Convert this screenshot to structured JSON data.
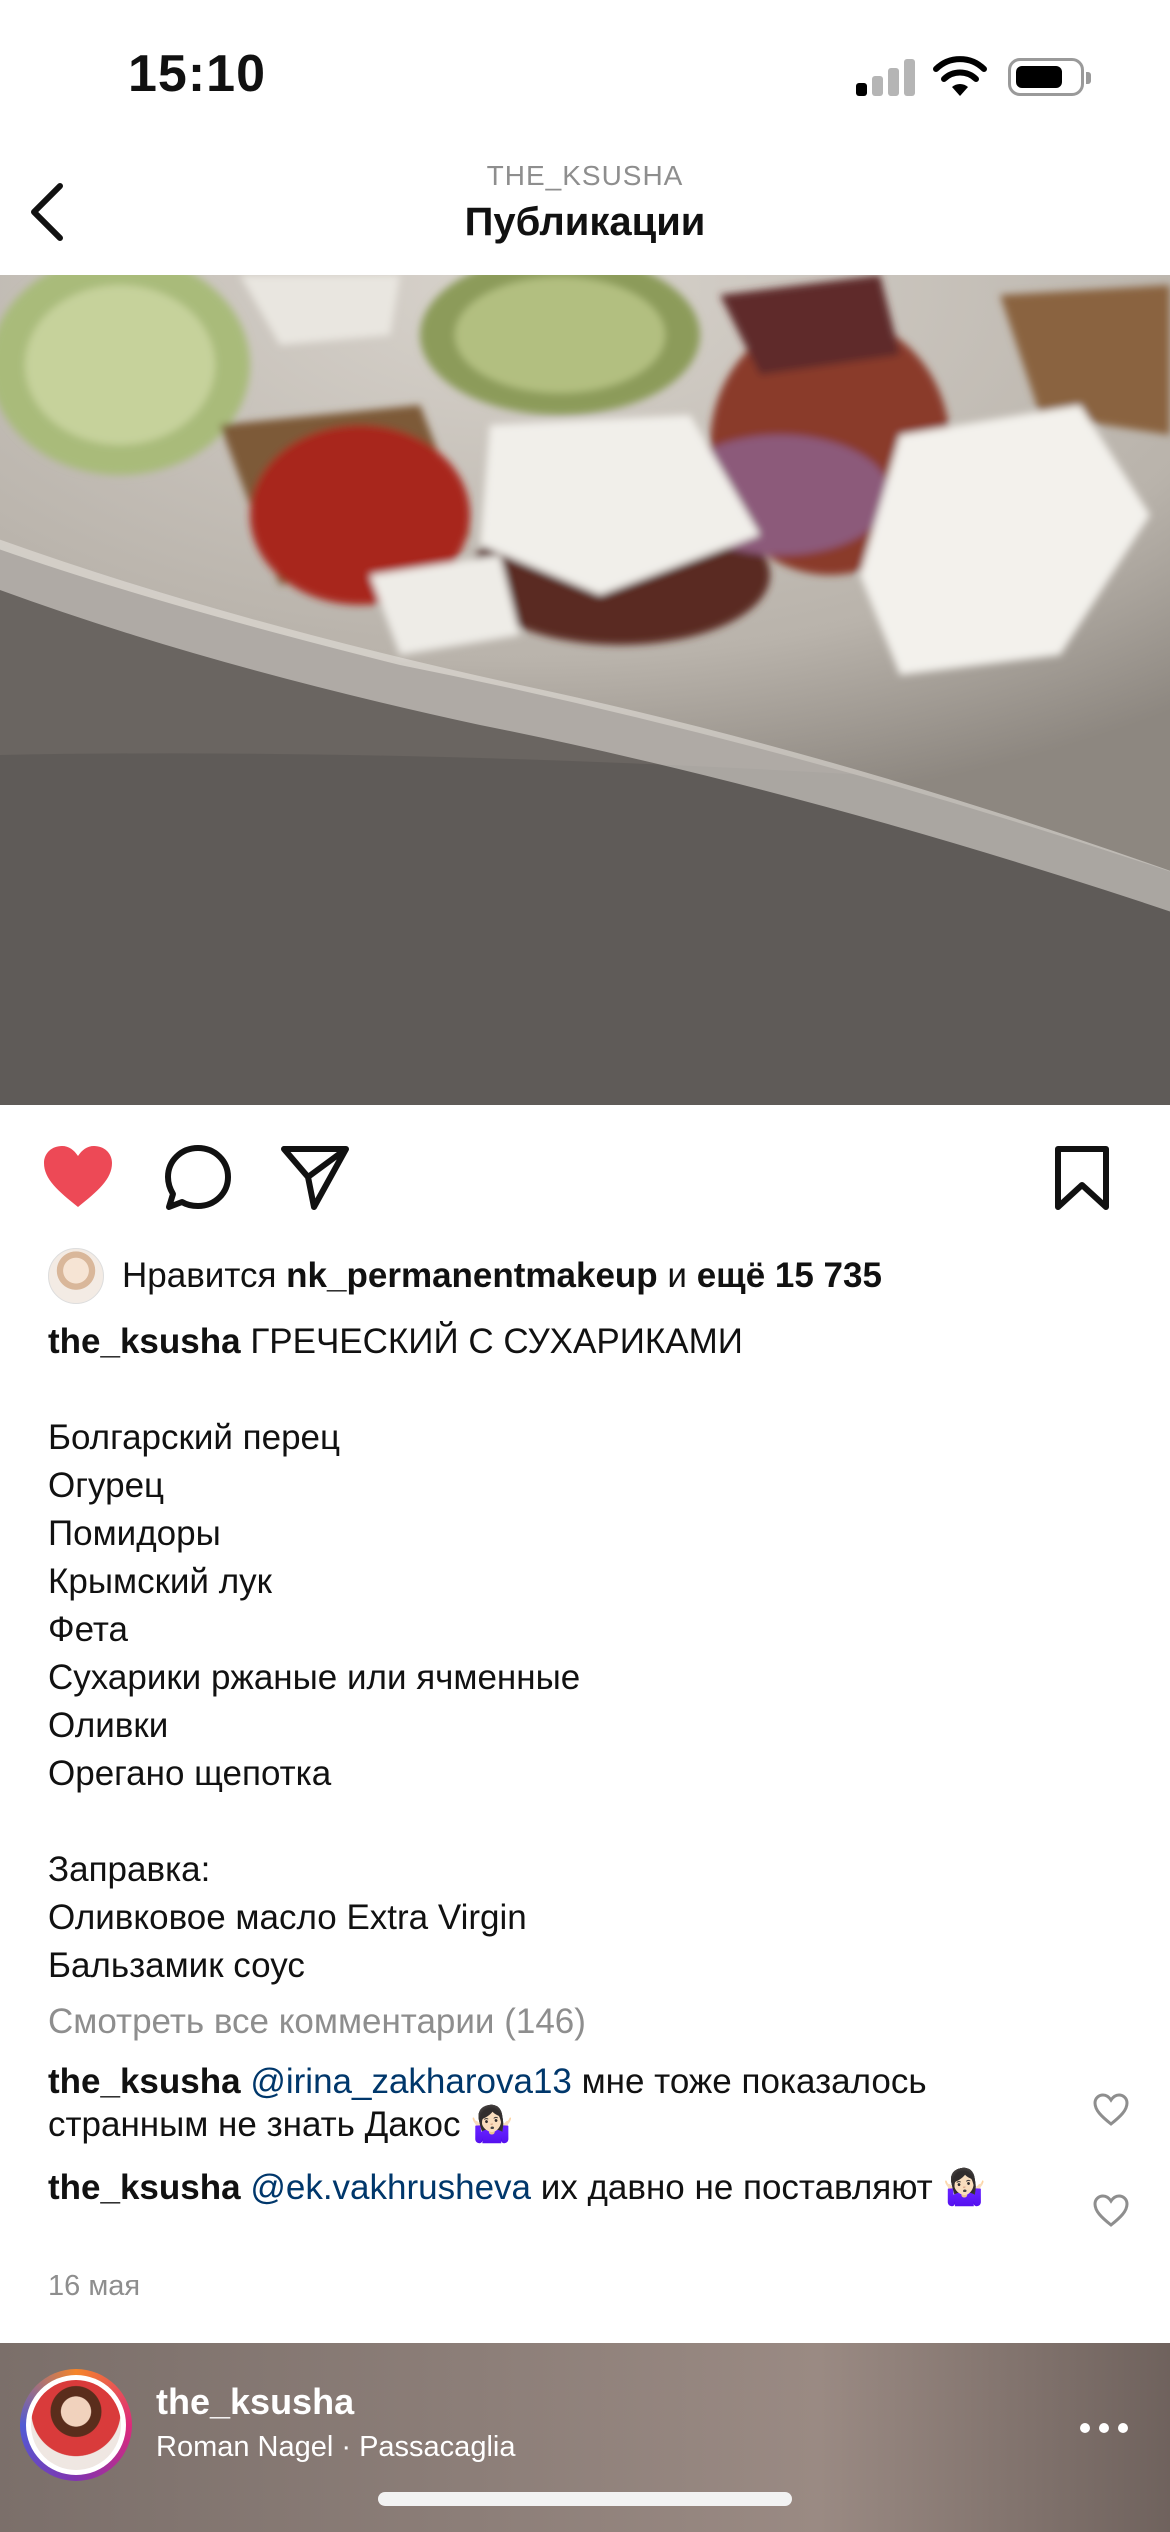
{
  "status_bar": {
    "time": "15:10"
  },
  "header": {
    "subtitle": "THE_KSUSHA",
    "title": "Публикации",
    "back_icon": "chevron-left-icon"
  },
  "post": {
    "media_alt": "salad-photo",
    "actions": {
      "liked": true,
      "like_color": "#ed4956"
    },
    "likes": {
      "prefix": "Нравится ",
      "user": "nk_permanentmakeup",
      "connector": " и ",
      "others": "ещё 15 735"
    },
    "caption": {
      "author": "the_ksusha",
      "title": " ГРЕЧЕСКИЙ С СУХАРИКАМИ",
      "ingredients": [
        "Болгарский перец",
        "Огурец",
        "Помидоры",
        "Крымский лук",
        "Фета",
        "Сухарики ржаные или ячменные",
        "Оливки",
        "Орегано щепотка"
      ],
      "dressing_title": "Заправка:",
      "dressing": [
        "Оливковое масло Extra Virgin",
        "Бальзамик соус"
      ]
    },
    "view_comments": "Смотреть все комментарии (146)",
    "comments": [
      {
        "author": "the_ksusha",
        "mention": "@irina_zakharova13",
        "text": " мне тоже показалось странным не знать Дакос 🤷🏻‍♀️"
      },
      {
        "author": "the_ksusha",
        "mention": "@ek.vakhrusheva",
        "text": " их давно не поставляют 🤷🏻‍♀️"
      }
    ],
    "date": "16 мая"
  },
  "mini_player": {
    "username": "the_ksusha",
    "track": "Roman Nagel · Passacaglia"
  },
  "colors": {
    "link": "#00376b",
    "secondary": "#8e8e8e",
    "like": "#ed4956"
  }
}
